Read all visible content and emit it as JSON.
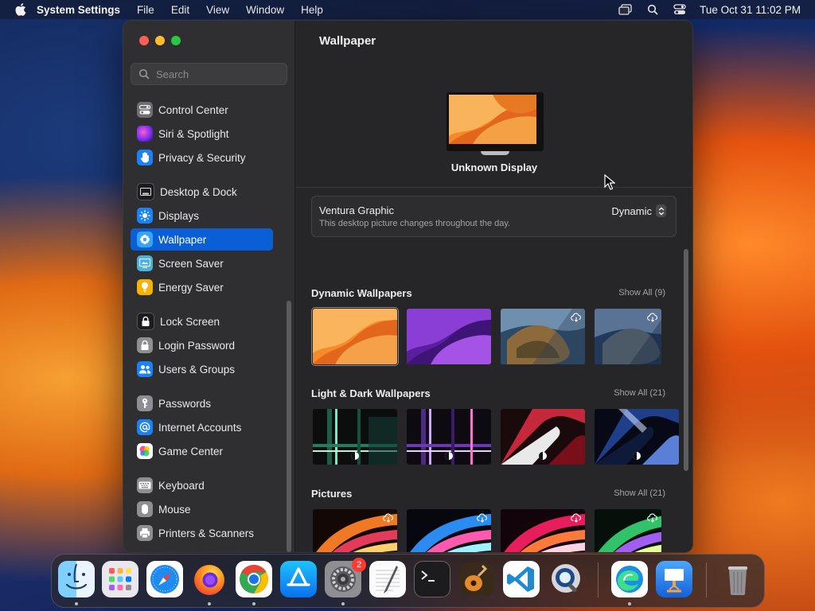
{
  "menubar": {
    "app_name": "System Settings",
    "items": [
      "File",
      "Edit",
      "View",
      "Window",
      "Help"
    ],
    "clock": "Tue Oct 31  11:02 PM"
  },
  "sidebar": {
    "search_placeholder": "Search",
    "items": [
      {
        "label": "Control Center",
        "icon": "control-center-icon",
        "color": "#6e6e73"
      },
      {
        "label": "Siri & Spotlight",
        "icon": "siri-icon",
        "color": "#a24bd6"
      },
      {
        "label": "Privacy & Security",
        "icon": "hand-icon",
        "color": "#1a82f7"
      },
      {
        "label": "Desktop & Dock",
        "icon": "dock-icon",
        "color": "#1c1c1e"
      },
      {
        "label": "Displays",
        "icon": "sun-icon",
        "color": "#1a82f7"
      },
      {
        "label": "Wallpaper",
        "icon": "wallpaper-icon",
        "color": "#34a6f5"
      },
      {
        "label": "Screen Saver",
        "icon": "screen-saver-icon",
        "color": "#48b3e0"
      },
      {
        "label": "Energy Saver",
        "icon": "bulb-icon",
        "color": "#f4b400"
      },
      {
        "label": "Lock Screen",
        "icon": "lock-icon",
        "color": "#1c1c1e"
      },
      {
        "label": "Login Password",
        "icon": "lock-icon",
        "color": "#8e8e93"
      },
      {
        "label": "Users & Groups",
        "icon": "users-icon",
        "color": "#1a82f7"
      },
      {
        "label": "Passwords",
        "icon": "key-icon",
        "color": "#8e8e93"
      },
      {
        "label": "Internet Accounts",
        "icon": "at-icon",
        "color": "#1a82f7"
      },
      {
        "label": "Game Center",
        "icon": "game-center-icon",
        "color": "#ffffff"
      },
      {
        "label": "Keyboard",
        "icon": "keyboard-icon",
        "color": "#8e8e93"
      },
      {
        "label": "Mouse",
        "icon": "mouse-icon",
        "color": "#8e8e93"
      },
      {
        "label": "Printers & Scanners",
        "icon": "printer-icon",
        "color": "#8e8e93"
      }
    ],
    "selected": "Wallpaper"
  },
  "main": {
    "title": "Wallpaper",
    "display_name": "Unknown Display",
    "current": {
      "name": "Ventura Graphic",
      "description": "This desktop picture changes throughout the day.",
      "mode": "Dynamic"
    },
    "sections": [
      {
        "title": "Dynamic Wallpapers",
        "show_all": "Show All (9)"
      },
      {
        "title": "Light & Dark Wallpapers",
        "show_all": "Show All (21)"
      },
      {
        "title": "Pictures",
        "show_all": "Show All (21)"
      }
    ]
  },
  "dock": {
    "apps": [
      "Finder",
      "Launchpad",
      "Safari",
      "Firefox",
      "Chrome",
      "App Store",
      "System Settings",
      "TextEdit",
      "Terminal",
      "Instruments",
      "Visual Studio Code",
      "QuickTime Player",
      "Microsoft Edge",
      "Keynote",
      "Trash"
    ],
    "settings_badge": "2"
  }
}
